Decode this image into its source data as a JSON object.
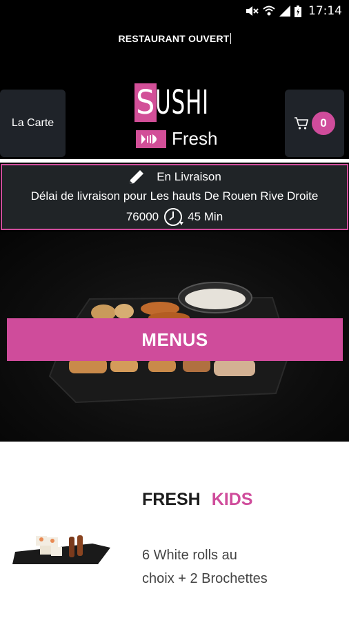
{
  "status_bar": {
    "time": "17:14",
    "icons": [
      "mute-icon",
      "wifi-icon",
      "signal-icon",
      "battery-icon"
    ]
  },
  "banner": {
    "text": "RESTAURANT OUVERT"
  },
  "header": {
    "menu_button_label": "La Carte",
    "cart_count": "0",
    "logo": {
      "word1": "SUSHI",
      "word2": "Fresh"
    }
  },
  "delivery": {
    "mode": "En Livraison",
    "delay_text": "Délai de livraison pour Les hauts De Rouen Rive Droite",
    "postal_code": "76000",
    "duration": "45 Min"
  },
  "hero": {
    "button_label": "MENUS"
  },
  "product": {
    "title_part1": "FRESH",
    "title_part2": "KIDS",
    "description": "6 White rolls au choix + 2 Brochettes"
  },
  "colors": {
    "accent": "#cf4c9b",
    "panel": "#1f2329",
    "background": "#000000"
  }
}
